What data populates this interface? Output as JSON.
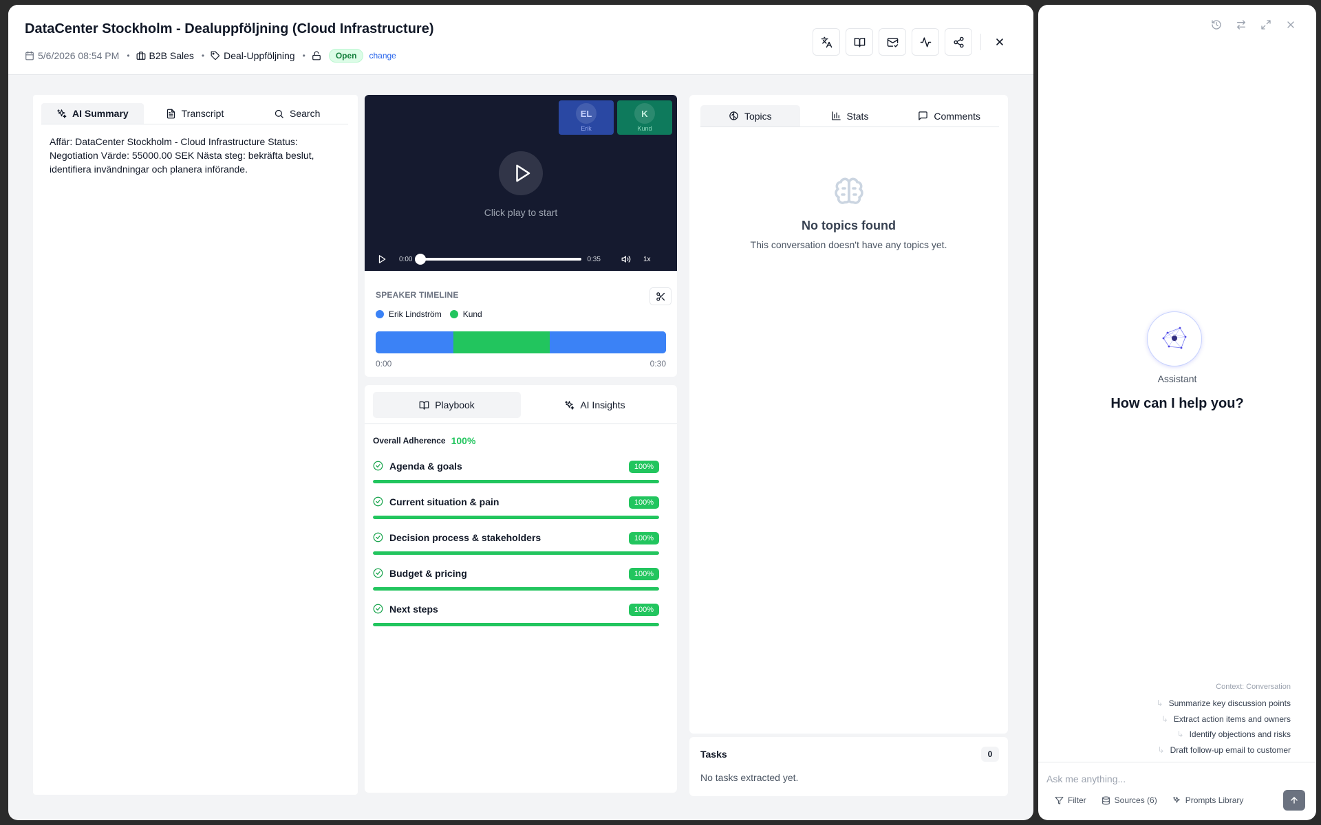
{
  "header": {
    "title": "DataCenter Stockholm - Dealuppföljning (Cloud Infrastructure)",
    "date": "5/6/2026 08:54 PM",
    "team": "B2B Sales",
    "tag": "Deal-Uppföljning",
    "status": "Open",
    "change_label": "change",
    "separator": "•"
  },
  "left_panel": {
    "tabs": [
      "AI Summary",
      "Transcript",
      "Search"
    ],
    "active_tab": "AI Summary",
    "summary": "Affär: DataCenter Stockholm - Cloud Infrastructure Status: Negotiation Värde: 55000.00 SEK Nästa steg: bekräfta beslut, identifiera invändningar och planera införande."
  },
  "video": {
    "participants": [
      {
        "initials": "EL",
        "name": "Erik",
        "bg": "#2a48a3",
        "fg": "#c7d2fe",
        "name_color": "#93a6e8"
      },
      {
        "initials": "K",
        "name": "Kund",
        "bg": "#0e7a5c",
        "fg": "#c7f0e0",
        "name_color": "#8fd9bd"
      }
    ],
    "prompt": "Click play to start",
    "current_time": "0:00",
    "duration": "0:35",
    "speed": "1x",
    "progress": 0
  },
  "timeline": {
    "label": "SPEAKER TIMELINE",
    "speakers": [
      {
        "name": "Erik Lindström",
        "color": "#3b82f6"
      },
      {
        "name": "Kund",
        "color": "#22c55e"
      }
    ],
    "segments": [
      {
        "speaker": "Erik Lindström",
        "start": 0,
        "end": 8,
        "color": "#3b82f6"
      },
      {
        "speaker": "Kund",
        "start": 8,
        "end": 18,
        "color": "#22c55e"
      },
      {
        "speaker": "Erik Lindström",
        "start": 18,
        "end": 30,
        "color": "#3b82f6"
      }
    ],
    "total_seconds": 30,
    "start_label": "0:00",
    "end_label": "0:30"
  },
  "playbook": {
    "tabs": [
      "Playbook",
      "AI Insights"
    ],
    "active_tab": "Playbook",
    "overall_label": "Overall Adherence",
    "overall_value": "100%",
    "items": [
      {
        "name": "Agenda & goals",
        "percent": "100%",
        "progress": 1.0
      },
      {
        "name": "Current situation & pain",
        "percent": "100%",
        "progress": 1.0
      },
      {
        "name": "Decision process & stakeholders",
        "percent": "100%",
        "progress": 1.0
      },
      {
        "name": "Budget & pricing",
        "percent": "100%",
        "progress": 1.0
      },
      {
        "name": "Next steps",
        "percent": "100%",
        "progress": 1.0
      }
    ]
  },
  "topics": {
    "tabs": [
      "Topics",
      "Stats",
      "Comments"
    ],
    "active_tab": "Topics",
    "empty_title": "No topics found",
    "empty_text": "This conversation doesn't have any topics yet."
  },
  "tasks": {
    "title": "Tasks",
    "count": "0",
    "empty_text": "No tasks extracted yet."
  },
  "assistant": {
    "label": "Assistant",
    "greeting": "How can I help you?",
    "context": "Context: Conversation",
    "suggestions": [
      "Summarize key discussion points",
      "Extract action items and owners",
      "Identify objections and risks",
      "Draft follow-up email to customer"
    ],
    "input_placeholder": "Ask me anything...",
    "filter_label": "Filter",
    "sources_label": "Sources (6)",
    "prompts_label": "Prompts Library"
  },
  "colors": {
    "accent_green": "#22c55e",
    "speaker_blue": "#3b82f6",
    "link_blue": "#2563eb",
    "video_bg": "#151a2f"
  }
}
